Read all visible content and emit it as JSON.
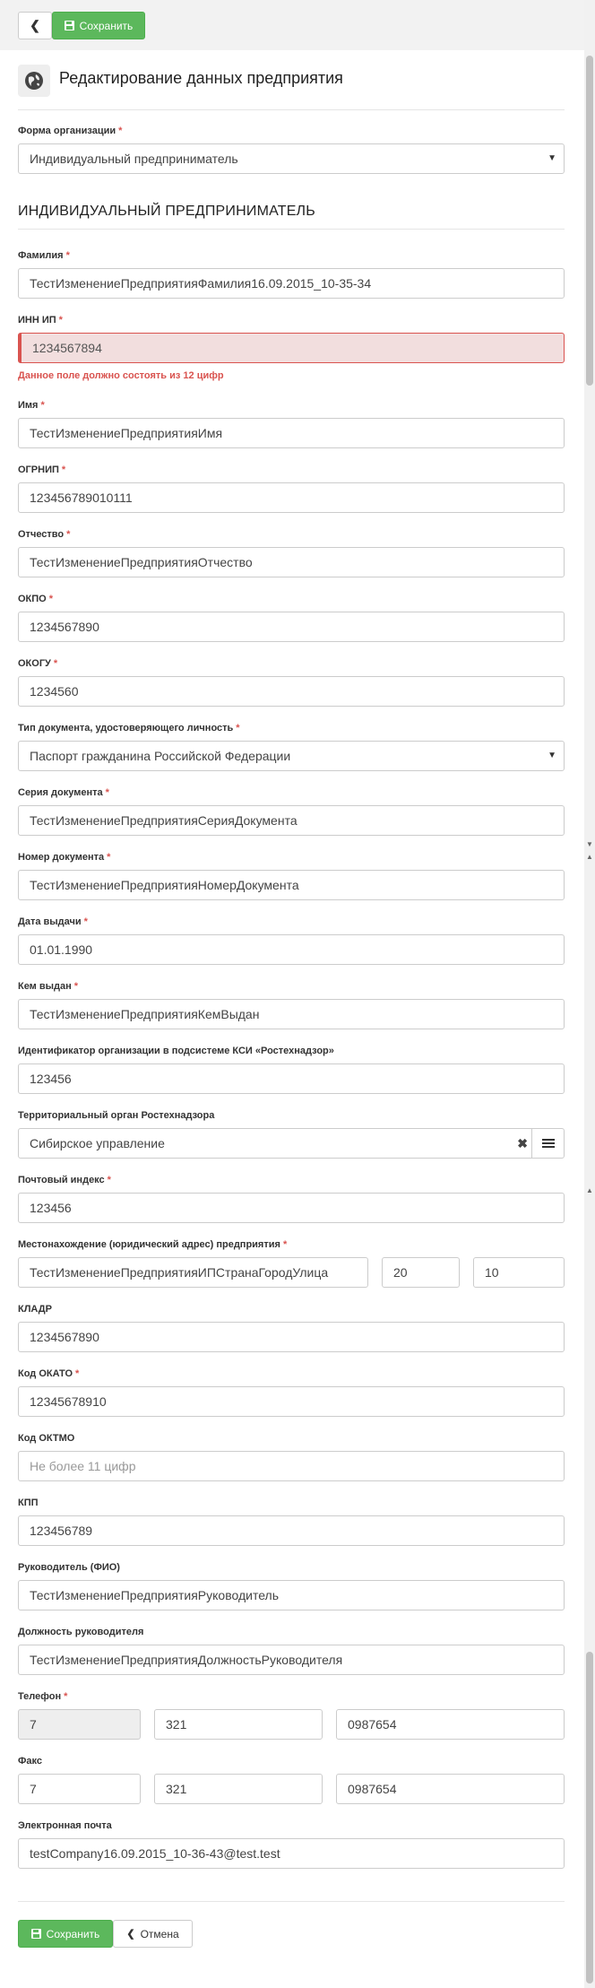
{
  "toolbar": {
    "back_icon": "chevron-left-icon",
    "save_label": "Сохранить",
    "save_icon": "floppy-disk-icon"
  },
  "header": {
    "icon": "globe-icon",
    "title": "Редактирование данных предприятия"
  },
  "org_form": {
    "label": "Форма организации",
    "value": "Индивидуальный предприниматель"
  },
  "section_title": "ИНДИВИДУАЛЬНЫЙ ПРЕДПРИНИМАТЕЛЬ",
  "fields": {
    "last_name": {
      "label": "Фамилия",
      "value": "ТестИзменениеПредприятияФамилия16.09.2015_10-35-34"
    },
    "inn": {
      "label": "ИНН ИП",
      "value": "1234567894",
      "error": "Данное поле должно состоять из 12 цифр"
    },
    "first_name": {
      "label": "Имя",
      "value": "ТестИзменениеПредприятияИмя"
    },
    "ogrnip": {
      "label": "ОГРНИП",
      "value": "123456789010111"
    },
    "middle_name": {
      "label": "Отчество",
      "value": "ТестИзменениеПредприятияОтчество"
    },
    "okpo": {
      "label": "ОКПО",
      "value": "1234567890"
    },
    "okogu": {
      "label": "ОКОГУ",
      "value": "1234560"
    },
    "id_doc_type": {
      "label": "Тип документа, удостоверяющего личность",
      "value": "Паспорт гражданина Российской Федерации"
    },
    "doc_series": {
      "label": "Серия документа",
      "value": "ТестИзменениеПредприятияСерияДокумента"
    },
    "doc_number": {
      "label": "Номер документа",
      "value": "ТестИзменениеПредприятияНомерДокумента"
    },
    "issue_date": {
      "label": "Дата выдачи",
      "value": "01.01.1990"
    },
    "issued_by": {
      "label": "Кем выдан",
      "value": "ТестИзменениеПредприятияКемВыдан"
    },
    "ksi_id": {
      "label": "Идентификатор организации в подсистеме КСИ «Ростехнадзор»",
      "value": "123456"
    },
    "territorial_body": {
      "label": "Территориальный орган Ростехнадзора",
      "value": "Сибирское управление"
    },
    "postal_code": {
      "label": "Почтовый индекс",
      "value": "123456"
    },
    "address": {
      "label": "Местонахождение (юридический адрес) предприятия",
      "street": "ТестИзменениеПредприятияИПСтранаГородУлица",
      "house": "20",
      "apartment": "10"
    },
    "kladr": {
      "label": "КЛАДР",
      "value": "1234567890"
    },
    "okato": {
      "label": "Код ОКАТО",
      "value": "12345678910"
    },
    "oktmo": {
      "label": "Код ОКТМО",
      "placeholder": "Не более 11 цифр"
    },
    "kpp": {
      "label": "КПП",
      "value": "123456789"
    },
    "director": {
      "label": "Руководитель (ФИО)",
      "value": "ТестИзменениеПредприятияРуководитель"
    },
    "director_position": {
      "label": "Должность руководителя",
      "value": "ТестИзменениеПредприятияДолжностьРуководителя"
    },
    "phone": {
      "label": "Телефон",
      "code": "7",
      "area": "321",
      "number": "0987654"
    },
    "fax": {
      "label": "Факс",
      "code": "7",
      "area": "321",
      "number": "0987654"
    },
    "email": {
      "label": "Электронная почта",
      "value": "testCompany16.09.2015_10-36-43@test.test"
    }
  },
  "footer": {
    "save_label": "Сохранить",
    "cancel_label": "Отмена",
    "cancel_icon": "chevron-left-icon"
  },
  "colors": {
    "primary": "#5cb85c",
    "error": "#d9534f",
    "error_bg": "#f2dede"
  }
}
